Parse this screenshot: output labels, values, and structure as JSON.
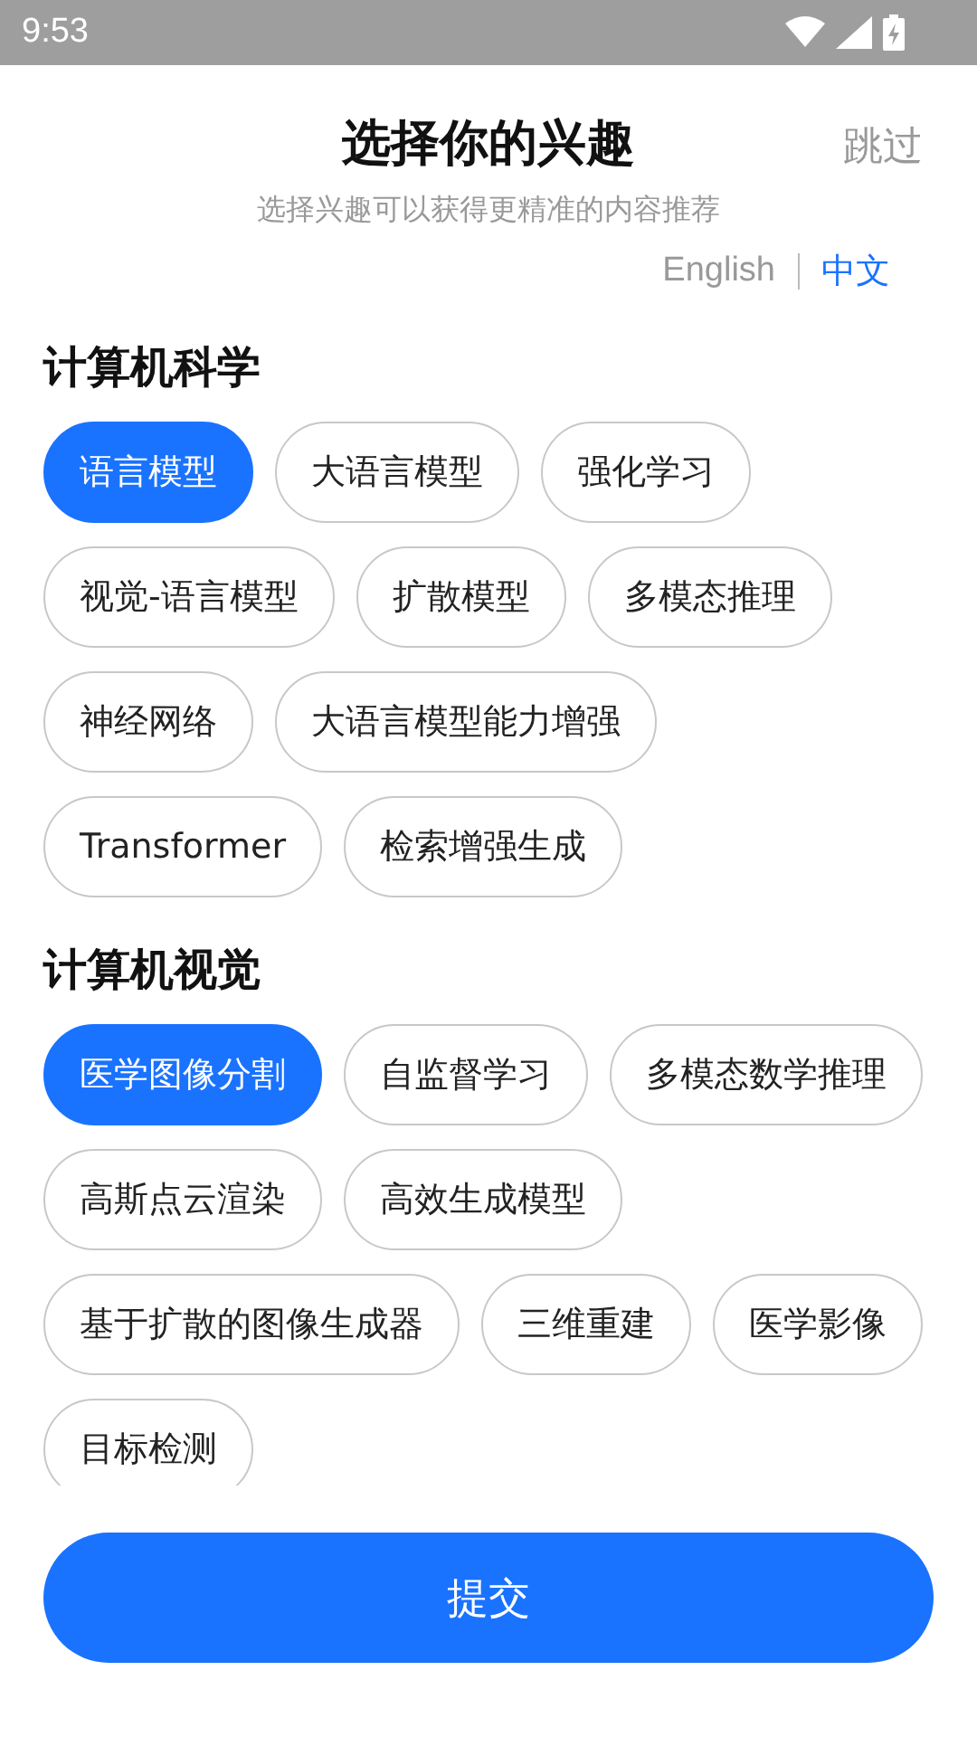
{
  "status_bar": {
    "time": "9:53"
  },
  "header": {
    "title": "选择你的兴趣",
    "skip": "跳过",
    "subtitle": "选择兴趣可以获得更精准的内容推荐"
  },
  "languages": [
    {
      "label": "English",
      "selected": false
    },
    {
      "label": "中文",
      "selected": true
    }
  ],
  "sections": [
    {
      "title": "计算机科学",
      "tags": [
        {
          "label": "语言模型",
          "selected": true
        },
        {
          "label": "大语言模型",
          "selected": false
        },
        {
          "label": "强化学习",
          "selected": false
        },
        {
          "label": "视觉-语言模型",
          "selected": false
        },
        {
          "label": "扩散模型",
          "selected": false
        },
        {
          "label": "多模态推理",
          "selected": false
        },
        {
          "label": "神经网络",
          "selected": false
        },
        {
          "label": "大语言模型能力增强",
          "selected": false
        },
        {
          "label": "Transformer",
          "selected": false
        },
        {
          "label": "检索增强生成",
          "selected": false
        }
      ]
    },
    {
      "title": "计算机视觉",
      "tags": [
        {
          "label": "医学图像分割",
          "selected": true
        },
        {
          "label": "自监督学习",
          "selected": false
        },
        {
          "label": "多模态数学推理",
          "selected": false
        },
        {
          "label": "高斯点云渲染",
          "selected": false
        },
        {
          "label": "高效生成模型",
          "selected": false
        },
        {
          "label": "基于扩散的图像生成器",
          "selected": false
        },
        {
          "label": "三维重建",
          "selected": false
        },
        {
          "label": "医学影像",
          "selected": false
        },
        {
          "label": "目标检测",
          "selected": false
        }
      ]
    }
  ],
  "submit": "提交"
}
